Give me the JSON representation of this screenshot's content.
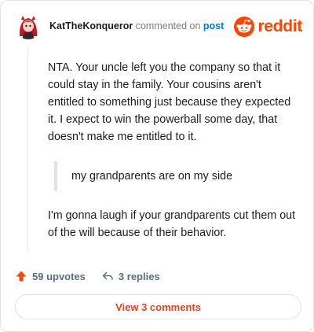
{
  "header": {
    "author": "KatTheKonqueror",
    "commented_on": "commented on",
    "post_link": "post",
    "brand": "reddit"
  },
  "comment": {
    "paragraph1": "NTA. Your uncle left you the company so that it could stay in the family. Your cousins aren't entitled to something just because they expected it. I expect to win the powerball some day, that doesn't make me entitled to it.",
    "quote": "my grandparents are on my side",
    "paragraph2": "I'm gonna laugh if your grandparents cut them out of the will because of their behavior."
  },
  "actions": {
    "upvotes": "59 upvotes",
    "replies": "3 replies"
  },
  "footer": {
    "view_comments": "View 3 comments"
  },
  "colors": {
    "brand": "#ff4500",
    "link": "#0079d3",
    "upvote": "#ff4500",
    "muted": "#7c7c7c"
  },
  "icons": [
    "avatar",
    "reddit-logo-icon",
    "upvote-arrow-icon",
    "reply-arrow-icon"
  ]
}
